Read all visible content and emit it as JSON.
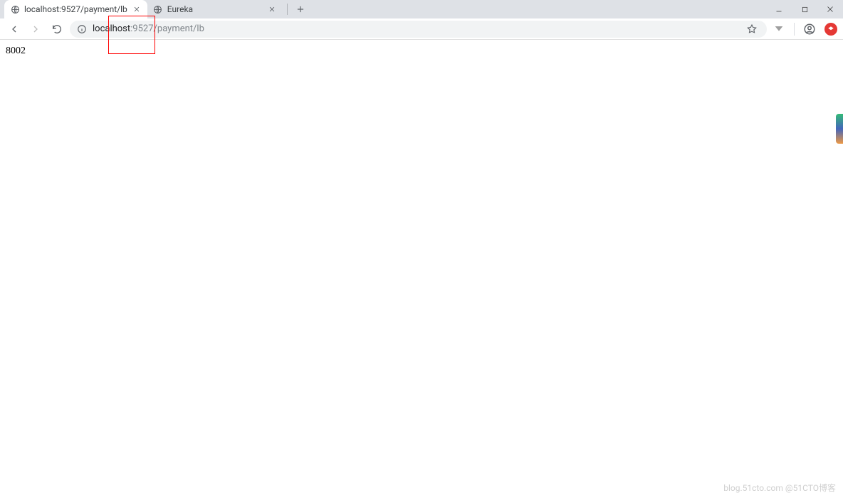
{
  "tabs": [
    {
      "title": "localhost:9527/payment/lb",
      "active": true
    },
    {
      "title": "Eureka",
      "active": false
    }
  ],
  "address_bar": {
    "host": "localhost",
    "port_path": ":9527/payment/lb"
  },
  "page": {
    "body_text": "8002"
  },
  "watermark": "blog.51cto.com @51CTO博客"
}
